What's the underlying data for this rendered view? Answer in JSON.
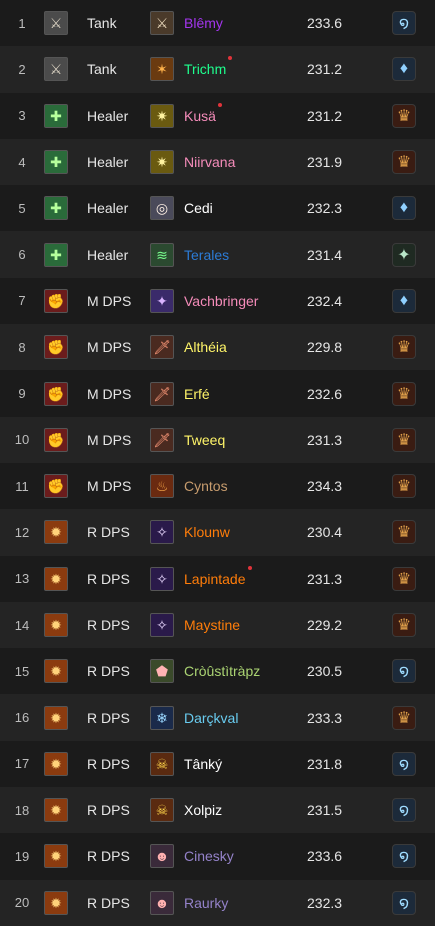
{
  "icon_styles": {
    "tank-role-icon": {
      "bg": "#4b4b4b",
      "fg": "#d8d0c0",
      "glyph": "⚔"
    },
    "healer-role-icon": {
      "bg": "#2a6b3a",
      "fg": "#b6ff9c",
      "glyph": "✚"
    },
    "melee-dps-role-icon": {
      "bg": "#6b1c1c",
      "fg": "#ffb2a1",
      "glyph": "✊"
    },
    "ranged-dps-role-icon": {
      "bg": "#8b3b0f",
      "fg": "#ffd27a",
      "glyph": "✹"
    },
    "warrior-spec-icon": {
      "bg": "#4a3a2a",
      "fg": "#e6d5b8",
      "glyph": "⚔"
    },
    "druid-spec-icon": {
      "bg": "#6a3a10",
      "fg": "#ffb24a",
      "glyph": "✶"
    },
    "paladin-spec-icon": {
      "bg": "#6a5a10",
      "fg": "#fff3a0",
      "glyph": "✷"
    },
    "priest-spec-icon": {
      "bg": "#4a4a5a",
      "fg": "#fff1e6",
      "glyph": "◎"
    },
    "monk-spec-icon": {
      "bg": "#2b4a30",
      "fg": "#79ff8f",
      "glyph": "≋"
    },
    "shadow-dps-spec-icon": {
      "bg": "#3a2a6a",
      "fg": "#d9b3ff",
      "glyph": "✦"
    },
    "rogue-spec-icon": {
      "bg": "#4a2a20",
      "fg": "#ff9a7a",
      "glyph": "🗡"
    },
    "demon-spec-icon": {
      "bg": "#6a2a10",
      "fg": "#ffae4a",
      "glyph": "♨"
    },
    "mage-spec-icon": {
      "bg": "#2a1a4a",
      "fg": "#e9d8ff",
      "glyph": "✧"
    },
    "hunter-spec-icon": {
      "bg": "#3a4a2a",
      "fg": "#ffb3b3",
      "glyph": "⬟"
    },
    "frost-spec-icon": {
      "bg": "#1a2a4a",
      "fg": "#9ad7ff",
      "glyph": "❄"
    },
    "warlock-spec-icon": {
      "bg": "#5a2a10",
      "fg": "#ffd54a",
      "glyph": "☠"
    },
    "shaman-spec-icon": {
      "bg": "#3a2a3a",
      "fg": "#ffb0b0",
      "glyph": "☻"
    }
  },
  "faction_styles": {
    "blue-swirl-icon": {
      "bg": "#1c2a3a",
      "fg": "#9fdcff",
      "glyph": "໑"
    },
    "blue-crystal-icon": {
      "bg": "#1c2a3a",
      "fg": "#8fd0ff",
      "glyph": "♦"
    },
    "red-crest-icon": {
      "bg": "#3a1c12",
      "fg": "#e0a04a",
      "glyph": "♛"
    },
    "green-crest-icon": {
      "bg": "#1f2a22",
      "fg": "#b8e6c8",
      "glyph": "✦"
    }
  },
  "rows": [
    {
      "num": "1",
      "role_icon": "tank-role-icon",
      "role": "Tank",
      "spec_icon": "warrior-spec-icon",
      "name": "Blêmy",
      "name_color": "#a335ee",
      "ilvl": "233.6",
      "faction_icon": "blue-swirl-icon",
      "dot": false
    },
    {
      "num": "2",
      "role_icon": "tank-role-icon",
      "role": "Tank",
      "spec_icon": "druid-spec-icon",
      "name": "Trichm",
      "name_color": "#1eff8e",
      "ilvl": "231.2",
      "faction_icon": "blue-crystal-icon",
      "dot": true
    },
    {
      "num": "3",
      "role_icon": "healer-role-icon",
      "role": "Healer",
      "spec_icon": "paladin-spec-icon",
      "name": "Kusä",
      "name_color": "#f58cba",
      "ilvl": "231.2",
      "faction_icon": "red-crest-icon",
      "dot": true
    },
    {
      "num": "4",
      "role_icon": "healer-role-icon",
      "role": "Healer",
      "spec_icon": "paladin-spec-icon",
      "name": "Niirvana",
      "name_color": "#f58cba",
      "ilvl": "231.9",
      "faction_icon": "red-crest-icon",
      "dot": false
    },
    {
      "num": "5",
      "role_icon": "healer-role-icon",
      "role": "Healer",
      "spec_icon": "priest-spec-icon",
      "name": "Cedi",
      "name_color": "#ffffff",
      "ilvl": "232.3",
      "faction_icon": "blue-crystal-icon",
      "dot": false
    },
    {
      "num": "6",
      "role_icon": "healer-role-icon",
      "role": "Healer",
      "spec_icon": "monk-spec-icon",
      "name": "Terales",
      "name_color": "#2c7bd6",
      "ilvl": "231.4",
      "faction_icon": "green-crest-icon",
      "dot": false
    },
    {
      "num": "7",
      "role_icon": "melee-dps-role-icon",
      "role": "M DPS",
      "spec_icon": "shadow-dps-spec-icon",
      "name": "Vachbringer",
      "name_color": "#f58cba",
      "ilvl": "232.4",
      "faction_icon": "blue-crystal-icon",
      "dot": false
    },
    {
      "num": "8",
      "role_icon": "melee-dps-role-icon",
      "role": "M DPS",
      "spec_icon": "rogue-spec-icon",
      "name": "Althéia",
      "name_color": "#fff569",
      "ilvl": "229.8",
      "faction_icon": "red-crest-icon",
      "dot": false
    },
    {
      "num": "9",
      "role_icon": "melee-dps-role-icon",
      "role": "M DPS",
      "spec_icon": "rogue-spec-icon",
      "name": "Erfé",
      "name_color": "#fff569",
      "ilvl": "232.6",
      "faction_icon": "red-crest-icon",
      "dot": false
    },
    {
      "num": "10",
      "role_icon": "melee-dps-role-icon",
      "role": "M DPS",
      "spec_icon": "rogue-spec-icon",
      "name": "Tweeq",
      "name_color": "#fff569",
      "ilvl": "231.3",
      "faction_icon": "red-crest-icon",
      "dot": false
    },
    {
      "num": "11",
      "role_icon": "melee-dps-role-icon",
      "role": "M DPS",
      "spec_icon": "demon-spec-icon",
      "name": "Cyntos",
      "name_color": "#c79c6e",
      "ilvl": "234.3",
      "faction_icon": "red-crest-icon",
      "dot": false
    },
    {
      "num": "12",
      "role_icon": "ranged-dps-role-icon",
      "role": "R DPS",
      "spec_icon": "mage-spec-icon",
      "name": "Klounw",
      "name_color": "#ff7d0a",
      "ilvl": "230.4",
      "faction_icon": "red-crest-icon",
      "dot": false
    },
    {
      "num": "13",
      "role_icon": "ranged-dps-role-icon",
      "role": "R DPS",
      "spec_icon": "mage-spec-icon",
      "name": "Lapintade",
      "name_color": "#ff7d0a",
      "ilvl": "231.3",
      "faction_icon": "red-crest-icon",
      "dot": true
    },
    {
      "num": "14",
      "role_icon": "ranged-dps-role-icon",
      "role": "R DPS",
      "spec_icon": "mage-spec-icon",
      "name": "Maystine",
      "name_color": "#ff7d0a",
      "ilvl": "229.2",
      "faction_icon": "red-crest-icon",
      "dot": false
    },
    {
      "num": "15",
      "role_icon": "ranged-dps-role-icon",
      "role": "R DPS",
      "spec_icon": "hunter-spec-icon",
      "name": "Cròûstìtràpz",
      "name_color": "#abd473",
      "ilvl": "230.5",
      "faction_icon": "blue-swirl-icon",
      "dot": false
    },
    {
      "num": "16",
      "role_icon": "ranged-dps-role-icon",
      "role": "R DPS",
      "spec_icon": "frost-spec-icon",
      "name": "Darçkval",
      "name_color": "#69ccf0",
      "ilvl": "233.3",
      "faction_icon": "red-crest-icon",
      "dot": false
    },
    {
      "num": "17",
      "role_icon": "ranged-dps-role-icon",
      "role": "R DPS",
      "spec_icon": "warlock-spec-icon",
      "name": "Tânký",
      "name_color": "#ffffff",
      "ilvl": "231.8",
      "faction_icon": "blue-swirl-icon",
      "dot": false
    },
    {
      "num": "18",
      "role_icon": "ranged-dps-role-icon",
      "role": "R DPS",
      "spec_icon": "warlock-spec-icon",
      "name": "Xolpiz",
      "name_color": "#ffffff",
      "ilvl": "231.5",
      "faction_icon": "blue-swirl-icon",
      "dot": false
    },
    {
      "num": "19",
      "role_icon": "ranged-dps-role-icon",
      "role": "R DPS",
      "spec_icon": "shaman-spec-icon",
      "name": "Cinesky",
      "name_color": "#9482c9",
      "ilvl": "233.6",
      "faction_icon": "blue-swirl-icon",
      "dot": false
    },
    {
      "num": "20",
      "role_icon": "ranged-dps-role-icon",
      "role": "R DPS",
      "spec_icon": "shaman-spec-icon",
      "name": "Raurky",
      "name_color": "#9482c9",
      "ilvl": "232.3",
      "faction_icon": "blue-swirl-icon",
      "dot": false
    }
  ]
}
